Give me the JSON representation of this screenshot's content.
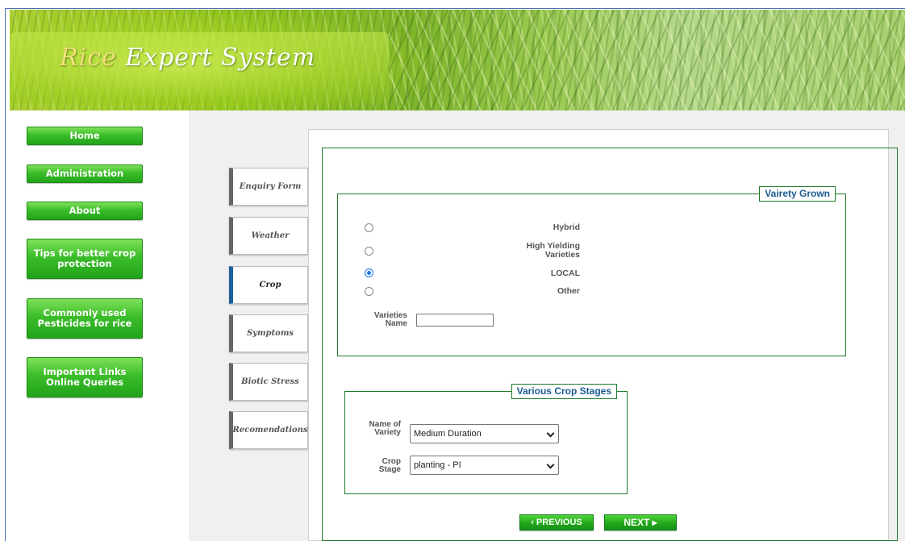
{
  "header": {
    "title_first": "Rice",
    "title_rest": " Expert System"
  },
  "sidebar": {
    "items": [
      {
        "label": "Home"
      },
      {
        "label": "Administration"
      },
      {
        "label": "About"
      },
      {
        "label": "Tips for better crop protection"
      },
      {
        "label": "Commonly used Pesticides for rice"
      },
      {
        "label": "Important Links Online Queries"
      }
    ]
  },
  "tabs": [
    {
      "label": "Enquiry Form",
      "active": false
    },
    {
      "label": "Weather",
      "active": false
    },
    {
      "label": "Crop",
      "active": true
    },
    {
      "label": "Symptoms",
      "active": false
    },
    {
      "label": "Biotic Stress",
      "active": false
    },
    {
      "label": "Recomendations",
      "active": false
    }
  ],
  "variety_grown": {
    "legend": "Vairety Grown",
    "options": [
      {
        "label": "Hybrid",
        "checked": false
      },
      {
        "label": "High Yielding Varieties",
        "checked": false
      },
      {
        "label": "LOCAL",
        "checked": true
      },
      {
        "label": "Other",
        "checked": false
      }
    ],
    "varieties_name_label": "Varieties Name",
    "varieties_name_value": ""
  },
  "crop_stages": {
    "legend": "Various Crop Stages",
    "name_of_variety_label": "Name of Variety",
    "name_of_variety_value": "Medium Duration",
    "crop_stage_label": "Crop Stage",
    "crop_stage_value": "planting - PI"
  },
  "pager": {
    "previous_label": "‹ PREVIOUS",
    "next_label": "NEXT ▸"
  },
  "colors": {
    "nav_green": "#2db422",
    "legend_text": "#1a5a8f",
    "fieldset_border": "#1e7a28",
    "active_tab_marker": "#1a5f9e"
  }
}
